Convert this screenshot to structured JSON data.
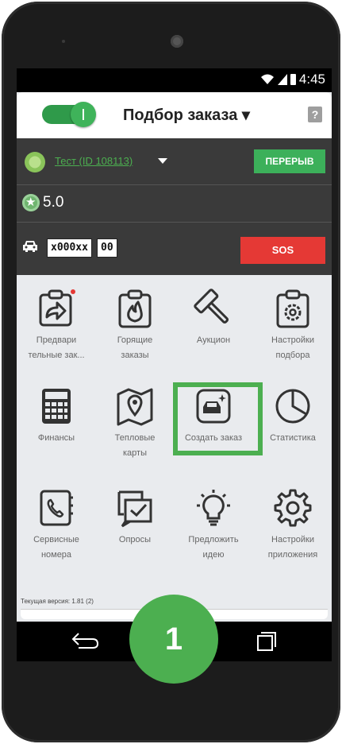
{
  "status": {
    "time": "4:45"
  },
  "header": {
    "title": "Подбор заказа ▾",
    "help": "?"
  },
  "driver": {
    "name": "Тест (ID 108113)",
    "break_button": "ПЕРЕРЫВ",
    "rating": "5.0"
  },
  "vehicle": {
    "plate": "х000хх",
    "region": "00",
    "sos_button": "SOS"
  },
  "tiles": [
    {
      "label1": "Предвари",
      "label2": "тельные зак..."
    },
    {
      "label1": "Горящие",
      "label2": "заказы"
    },
    {
      "label1": "Аукцион",
      "label2": ""
    },
    {
      "label1": "Настройки",
      "label2": "подбора"
    },
    {
      "label1": "Финансы",
      "label2": ""
    },
    {
      "label1": "Тепловые",
      "label2": "карты"
    },
    {
      "label1": "Создать заказ",
      "label2": ""
    },
    {
      "label1": "Статистика",
      "label2": ""
    },
    {
      "label1": "Сервисные",
      "label2": "номера"
    },
    {
      "label1": "Опросы",
      "label2": ""
    },
    {
      "label1": "Предложить",
      "label2": "идею"
    },
    {
      "label1": "Настройки",
      "label2": "приложения"
    }
  ],
  "footer": {
    "version": "Текущая версия: 1.81 (2)"
  },
  "step_badge": "1",
  "colors": {
    "accent_green": "#4caf50",
    "sos_red": "#e53935",
    "dark_bg": "#3a3a3a"
  }
}
